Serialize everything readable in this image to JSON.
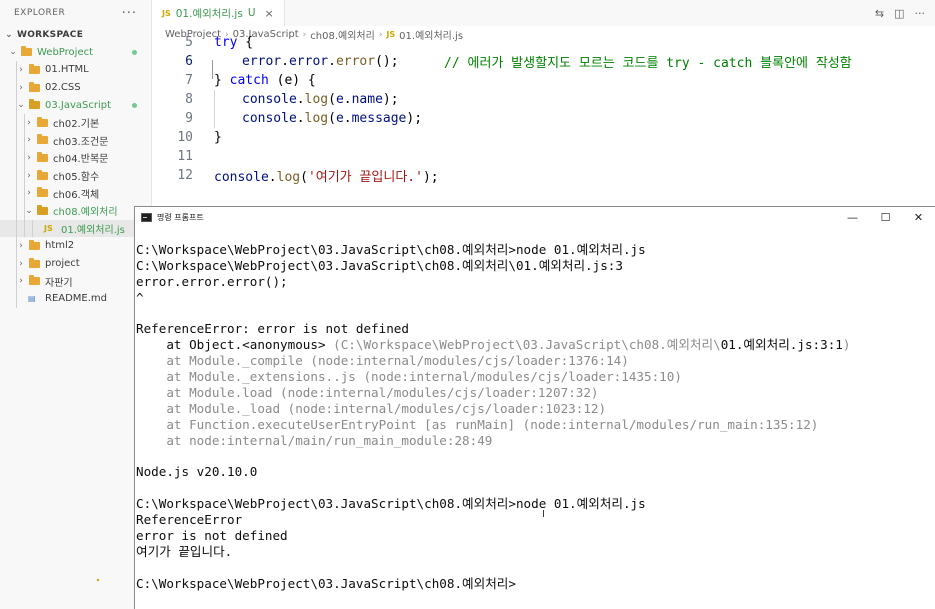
{
  "explorer": {
    "title": "EXPLORER",
    "more": "···",
    "workspace": "WORKSPACE",
    "items": [
      {
        "label": "WebProject",
        "kind": "folder",
        "state": "open"
      },
      {
        "label": "01.HTML",
        "kind": "folder",
        "state": "closed"
      },
      {
        "label": "02.CSS",
        "kind": "folder",
        "state": "closed"
      },
      {
        "label": "03.JavaScript",
        "kind": "folder",
        "state": "open"
      },
      {
        "label": "ch02.기본",
        "kind": "folder",
        "state": "closed"
      },
      {
        "label": "ch03.조건문",
        "kind": "folder",
        "state": "closed"
      },
      {
        "label": "ch04.반복문",
        "kind": "folder",
        "state": "closed"
      },
      {
        "label": "ch05.함수",
        "kind": "folder",
        "state": "closed"
      },
      {
        "label": "ch06.객체",
        "kind": "folder",
        "state": "closed"
      },
      {
        "label": "ch08.예외처리",
        "kind": "folder",
        "state": "open"
      },
      {
        "label": "01.예외처리.js",
        "kind": "file",
        "badge": "U"
      },
      {
        "label": "html2",
        "kind": "folder",
        "state": "closed"
      },
      {
        "label": "project",
        "kind": "folder",
        "state": "closed"
      },
      {
        "label": "자판기",
        "kind": "folder",
        "state": "closed"
      },
      {
        "label": "README.md",
        "kind": "file"
      }
    ]
  },
  "editor": {
    "tab": {
      "icon": "JS",
      "label": "01.예외처리.js",
      "badge": "U",
      "close": "×"
    },
    "breadcrumb": [
      "WebProject",
      "03.JavaScript",
      "ch08.예외처리",
      "01.예외처리.js"
    ],
    "breadcrumb_icon": "JS",
    "line_numbers": [
      "5",
      "6",
      "7",
      "8",
      "9",
      "10",
      "11",
      "12"
    ],
    "code": {
      "l5": {
        "kw": "try",
        "rest": " {"
      },
      "l6": {
        "obj": "error",
        "dot1": ".",
        "p1": "error",
        "dot2": ".",
        "fn": "error",
        "tail": "();",
        "comment": "// 에러가 발생할지도 모르는 코드를 try - catch 블록안에 작성함"
      },
      "l7": {
        "open": "} ",
        "kw": "catch",
        "rest": " (e) {"
      },
      "l8": {
        "obj": "console",
        "fn": "log",
        "arg": "e",
        "prop": "name"
      },
      "l9": {
        "obj": "console",
        "fn": "log",
        "arg": "e",
        "prop": "message"
      },
      "l10": {
        "text": "}"
      },
      "l12": {
        "obj": "console",
        "fn": "log",
        "str": "'여기가 끝입니다.'"
      }
    }
  },
  "terminal": {
    "title": "명령 프롬프트",
    "controls": [
      "—",
      "☐",
      "✕"
    ],
    "lines": [
      {
        "text": "C:\\Workspace\\WebProject\\03.JavaScript\\ch08.예외처리>node 01.예외처리.js",
        "dim": false
      },
      {
        "text": "C:\\Workspace\\WebProject\\03.JavaScript\\ch08.예외처리\\01.예외처리.js:3",
        "dim": false
      },
      {
        "text": "error.error.error();",
        "dim": false
      },
      {
        "text": "^",
        "dim": false
      },
      {
        "text": "",
        "dim": false
      },
      {
        "text": "ReferenceError: error is not defined",
        "dim": false
      },
      {
        "text": "    at Object.<anonymous> (C:\\Workspace\\WebProject\\03.JavaScript\\ch08.예외처리\\01.예외처리.js:3:1)",
        "dim": "mixed"
      },
      {
        "text": "    at Module._compile (node:internal/modules/cjs/loader:1376:14)",
        "dim": true
      },
      {
        "text": "    at Module._extensions..js (node:internal/modules/cjs/loader:1435:10)",
        "dim": true
      },
      {
        "text": "    at Module.load (node:internal/modules/cjs/loader:1207:32)",
        "dim": true
      },
      {
        "text": "    at Module._load (node:internal/modules/cjs/loader:1023:12)",
        "dim": true
      },
      {
        "text": "    at Function.executeUserEntryPoint [as runMain] (node:internal/modules/run_main:135:12)",
        "dim": true
      },
      {
        "text": "    at node:internal/main/run_main_module:28:49",
        "dim": true
      },
      {
        "text": "",
        "dim": false
      },
      {
        "text": "Node.js v20.10.0",
        "dim": false
      },
      {
        "text": "",
        "dim": false
      },
      {
        "text": "C:\\Workspace\\WebProject\\03.JavaScript\\ch08.예외처리>node 01.예외처리.js",
        "dim": false
      },
      {
        "text": "ReferenceError",
        "dim": false
      },
      {
        "text": "error is not defined",
        "dim": false
      },
      {
        "text": "여기가 끝입니다.",
        "dim": false
      },
      {
        "text": "",
        "dim": false
      },
      {
        "text": "C:\\Workspace\\WebProject\\03.JavaScript\\ch08.예외처리>",
        "dim": false
      }
    ],
    "stack_first": {
      "prefix": "    at Object.<anonymous> ",
      "dim_part": "(C:\\Workspace\\WebProject\\03.JavaScript\\ch08.예외처리\\",
      "bright_part": "01.예외처리.js:3:1",
      "suffix": ")"
    }
  },
  "colors": {
    "git_untracked": "#3d9a50",
    "keyword": "#0000ff",
    "function": "#795e26",
    "variable": "#001080",
    "string": "#a31515",
    "comment": "#008000",
    "folder": "#e8a838",
    "folder_js": "#d8a022"
  }
}
